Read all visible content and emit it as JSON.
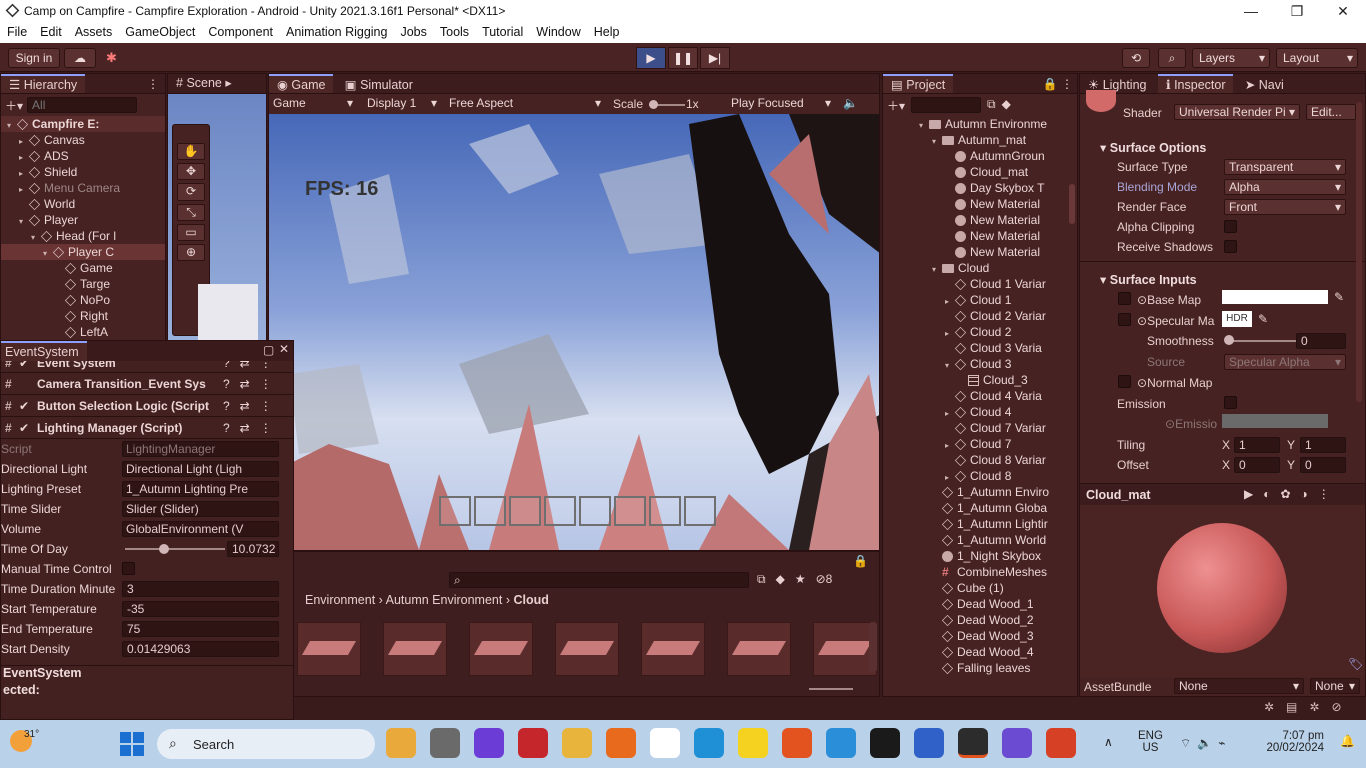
{
  "window": {
    "title": "Camp on Campfire - Campfire Exploration - Android - Unity 2021.3.16f1 Personal* <DX11>"
  },
  "menu": [
    "File",
    "Edit",
    "Assets",
    "GameObject",
    "Component",
    "Animation Rigging",
    "Jobs",
    "Tools",
    "Tutorial",
    "Window",
    "Help"
  ],
  "toolbar": {
    "signin": "Sign in",
    "layers": "Layers",
    "layout": "Layout"
  },
  "hierarchy": {
    "tab": "Hierarchy",
    "search_placeholder": "All",
    "items": [
      {
        "label": "Campfire E:",
        "depth": 0
      },
      {
        "label": "Canvas",
        "depth": 1
      },
      {
        "label": "ADS",
        "depth": 1
      },
      {
        "label": "Shield",
        "depth": 1
      },
      {
        "label": "Menu Camera",
        "depth": 1
      },
      {
        "label": "World",
        "depth": 1
      },
      {
        "label": "Player",
        "depth": 1
      },
      {
        "label": "Head (For l",
        "depth": 2
      },
      {
        "label": "Player C",
        "depth": 3
      },
      {
        "label": "Game",
        "depth": 4
      },
      {
        "label": "Targe",
        "depth": 4
      },
      {
        "label": "NoPo",
        "depth": 4
      },
      {
        "label": "Right",
        "depth": 4
      },
      {
        "label": "LeftA",
        "depth": 4
      }
    ]
  },
  "scene": {
    "tab": "Scene"
  },
  "game": {
    "tabs": [
      "Game",
      "Simulator"
    ],
    "controls": {
      "mode": "Game",
      "display": "Display 1",
      "aspect": "Free Aspect",
      "scale_label": "Scale",
      "scale_value": "1x",
      "play_focus": "Play Focused"
    },
    "fps": "FPS: 16"
  },
  "eventsystem": {
    "title": "EventSystem",
    "components": [
      "Event System",
      "Camera Transition_Event Sys",
      "Button Selection Logic (Script",
      "Lighting Manager (Script)"
    ],
    "fields": [
      {
        "label": "Script",
        "value": "LightingManager"
      },
      {
        "label": "Directional Light",
        "value": "Directional Light (Ligh"
      },
      {
        "label": "Lighting Preset",
        "value": "1_Autumn Lighting Pre"
      },
      {
        "label": "Time Slider",
        "value": "Slider (Slider)"
      },
      {
        "label": "Volume",
        "value": "GlobalEnvironment (V"
      },
      {
        "label": "Time Of Day",
        "value": "10.0732"
      },
      {
        "label": "Manual Time Control",
        "value": ""
      },
      {
        "label": "Time Duration Minute",
        "value": "3"
      },
      {
        "label": "Start Temperature",
        "value": "-35"
      },
      {
        "label": "End Temperature",
        "value": "75"
      },
      {
        "label": "Start Density",
        "value": "0.01429063"
      }
    ],
    "footer_title": "EventSystem",
    "footer_selected": "ected:"
  },
  "project_browser": {
    "breadcrumb": [
      "Environment",
      "Autumn Environment",
      "Cloud"
    ],
    "hidden_count": "8"
  },
  "project": {
    "tab": "Project",
    "items": [
      {
        "label": "Autumn Environme",
        "depth": 0,
        "kind": "folder",
        "arrow": "open"
      },
      {
        "label": "Autumn_mat",
        "depth": 1,
        "kind": "folder",
        "arrow": "open"
      },
      {
        "label": "AutumnGroun",
        "depth": 2,
        "kind": "mat",
        "arrow": ""
      },
      {
        "label": "Cloud_mat",
        "depth": 2,
        "kind": "mat",
        "arrow": ""
      },
      {
        "label": "Day Skybox T",
        "depth": 2,
        "kind": "mat",
        "arrow": ""
      },
      {
        "label": "New Material",
        "depth": 2,
        "kind": "mat",
        "arrow": ""
      },
      {
        "label": "New Material",
        "depth": 2,
        "kind": "mat",
        "arrow": ""
      },
      {
        "label": "New Material",
        "depth": 2,
        "kind": "mat",
        "arrow": ""
      },
      {
        "label": "New Material",
        "depth": 2,
        "kind": "mat",
        "arrow": ""
      },
      {
        "label": "Cloud",
        "depth": 1,
        "kind": "folder",
        "arrow": "open"
      },
      {
        "label": "Cloud 1 Variar",
        "depth": 2,
        "kind": "cube",
        "arrow": ""
      },
      {
        "label": "Cloud 1",
        "depth": 2,
        "kind": "cube",
        "arrow": "closed"
      },
      {
        "label": "Cloud 2 Variar",
        "depth": 2,
        "kind": "cube",
        "arrow": ""
      },
      {
        "label": "Cloud 2",
        "depth": 2,
        "kind": "cube",
        "arrow": "closed"
      },
      {
        "label": "Cloud 3 Varia",
        "depth": 2,
        "kind": "cube",
        "arrow": ""
      },
      {
        "label": "Cloud 3",
        "depth": 2,
        "kind": "cube",
        "arrow": "open"
      },
      {
        "label": "Cloud_3",
        "depth": 3,
        "kind": "grid",
        "arrow": ""
      },
      {
        "label": "Cloud 4 Varia",
        "depth": 2,
        "kind": "cube",
        "arrow": ""
      },
      {
        "label": "Cloud 4",
        "depth": 2,
        "kind": "cube",
        "arrow": "closed"
      },
      {
        "label": "Cloud 7 Variar",
        "depth": 2,
        "kind": "cube",
        "arrow": ""
      },
      {
        "label": "Cloud 7",
        "depth": 2,
        "kind": "cube",
        "arrow": "closed"
      },
      {
        "label": "Cloud 8 Variar",
        "depth": 2,
        "kind": "cube",
        "arrow": ""
      },
      {
        "label": "Cloud 8",
        "depth": 2,
        "kind": "cube",
        "arrow": "closed"
      },
      {
        "label": "1_Autumn Enviro",
        "depth": 1,
        "kind": "cube",
        "arrow": ""
      },
      {
        "label": "1_Autumn Globa",
        "depth": 1,
        "kind": "cube",
        "arrow": ""
      },
      {
        "label": "1_Autumn Lightir",
        "depth": 1,
        "kind": "cube",
        "arrow": ""
      },
      {
        "label": "1_Autumn World",
        "depth": 1,
        "kind": "cube",
        "arrow": ""
      },
      {
        "label": "1_Night Skybox",
        "depth": 1,
        "kind": "mat",
        "arrow": ""
      },
      {
        "label": "CombineMeshes",
        "depth": 1,
        "kind": "script",
        "arrow": ""
      },
      {
        "label": "Cube (1)",
        "depth": 1,
        "kind": "cube",
        "arrow": ""
      },
      {
        "label": "Dead Wood_1",
        "depth": 1,
        "kind": "cube",
        "arrow": ""
      },
      {
        "label": "Dead Wood_2",
        "depth": 1,
        "kind": "cube",
        "arrow": ""
      },
      {
        "label": "Dead Wood_3",
        "depth": 1,
        "kind": "cube",
        "arrow": ""
      },
      {
        "label": "Dead Wood_4",
        "depth": 1,
        "kind": "cube",
        "arrow": ""
      },
      {
        "label": "Falling leaves",
        "depth": 1,
        "kind": "cube",
        "arrow": ""
      }
    ]
  },
  "inspector": {
    "tabs": [
      "Lighting",
      "Inspector",
      "Navi"
    ],
    "shader_label": "Shader",
    "shader_value": "Universal Render Pi",
    "edit": "Edit...",
    "surface_options": "Surface Options",
    "surface_type_label": "Surface Type",
    "surface_type": "Transparent",
    "blending_mode_label": "Blending Mode",
    "blending_mode": "Alpha",
    "render_face_label": "Render Face",
    "render_face": "Front",
    "alpha_clipping": "Alpha Clipping",
    "receive_shadows": "Receive Shadows",
    "surface_inputs": "Surface Inputs",
    "base_map": "Base Map",
    "specular_map": "Specular Ma",
    "hdr": "HDR",
    "smoothness_label": "Smoothness",
    "smoothness": "0",
    "source_label": "Source",
    "source": "Specular Alpha",
    "normal_map": "Normal Map",
    "emission": "Emission",
    "emission_map": "Emissio",
    "tiling_label": "Tiling",
    "tiling_x": "1",
    "tiling_y": "1",
    "offset_label": "Offset",
    "offset_x": "0",
    "offset_y": "0",
    "x": "X",
    "y": "Y",
    "preview_title": "Cloud_mat",
    "assetbundle_label": "AssetBundle",
    "assetbundle": "None",
    "assetbundle_variant": "None"
  },
  "taskbar": {
    "weather": "31°",
    "search": "Search",
    "lang1": "ENG",
    "lang2": "US",
    "time": "7:07 pm",
    "date": "20/02/2024"
  }
}
